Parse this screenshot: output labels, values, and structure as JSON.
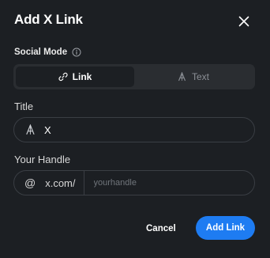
{
  "dialog": {
    "title": "Add X Link",
    "close_icon": "close-icon"
  },
  "social_mode": {
    "label": "Social Mode",
    "info_icon": "info-icon",
    "options": [
      {
        "label": "Link",
        "icon": "link-icon",
        "selected": true
      },
      {
        "label": "Text",
        "icon": "text-icon",
        "selected": false
      }
    ]
  },
  "title_field": {
    "label": "Title",
    "icon": "text-icon",
    "value": "X"
  },
  "handle_field": {
    "label": "Your Handle",
    "prefix_symbol": "@",
    "domain": "x.com/",
    "placeholder": "yourhandle",
    "value": ""
  },
  "actions": {
    "cancel_label": "Cancel",
    "submit_label": "Add Link"
  },
  "colors": {
    "background": "#1c1f23",
    "accent": "#1e7cf2",
    "segment_track": "#2a2d31",
    "border": "#3a3e44"
  }
}
